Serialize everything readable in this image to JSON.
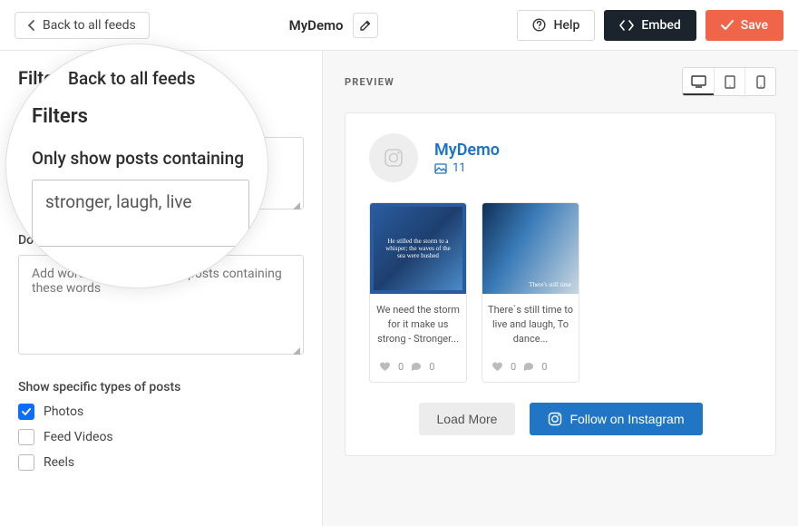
{
  "topbar": {
    "back_label": "Back to all feeds",
    "feed_name": "MyDemo",
    "help_label": "Help",
    "embed_label": "Embed",
    "save_label": "Save"
  },
  "filters": {
    "heading": "Filters",
    "only_show_label": "Only show posts containing",
    "only_show_value": "stronger, laugh, live",
    "do_not_show_label": "Do not show posts containing",
    "do_not_show_placeholder": "Add words here to hide any posts containing these words",
    "types_heading": "Show specific types of posts",
    "types": [
      {
        "label": "Photos",
        "checked": true
      },
      {
        "label": "Feed Videos",
        "checked": false
      },
      {
        "label": "Reels",
        "checked": false
      }
    ]
  },
  "preview": {
    "heading": "PREVIEW",
    "profile": {
      "name": "MyDemo",
      "post_count": "11"
    },
    "posts": [
      {
        "img_text": "He stilled the storm to a whisper; the waves of the sea were hushed",
        "caption": "We need the storm for it make us strong - Stronger...",
        "likes": "0",
        "comments": "0"
      },
      {
        "img_text": "There's still time",
        "caption": "There`s still time to live and laugh, To dance...",
        "likes": "0",
        "comments": "0"
      }
    ],
    "load_more_label": "Load More",
    "follow_label": "Follow on Instagram"
  }
}
